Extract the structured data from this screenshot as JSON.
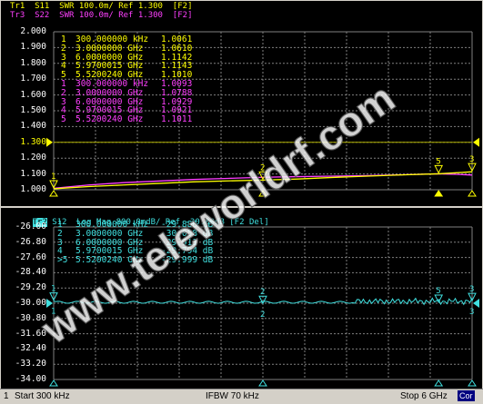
{
  "top": {
    "trace1_header": "Tr1  S11  SWR 100.0m/ Ref 1.300  [F2]",
    "trace3_header": "Tr3  S22  SWR 100.0m/ Ref 1.300  [F2]",
    "colors": {
      "tr1": "#ffff00",
      "tr3": "#ff40ff"
    },
    "y_labels": [
      "2.000",
      "1.900",
      "1.800",
      "1.700",
      "1.600",
      "1.500",
      "1.400",
      "1.300",
      "1.200",
      "1.100",
      "1.000"
    ],
    "ref_label": "1.300",
    "markers_tr1": [
      {
        "n": "1",
        "f": "300.000000 kHz",
        "v": "1.0061"
      },
      {
        "n": "2",
        "f": "3.0000000 GHz",
        "v": "1.0610"
      },
      {
        "n": "3",
        "f": "6.0000000 GHz",
        "v": "1.1142"
      },
      {
        "n": "4",
        "f": "5.9700015 GHz",
        "v": "1.1143"
      },
      {
        "n": "5",
        "f": "5.5200240 GHz",
        "v": "1.1010"
      }
    ],
    "markers_tr3": [
      {
        "n": "1",
        "f": "300.000000 kHz",
        "v": "1.0093"
      },
      {
        "n": "2",
        "f": "3.0000000 GHz",
        "v": "1.0788"
      },
      {
        "n": "3",
        "f": "6.0000000 GHz",
        "v": "1.0929"
      },
      {
        "n": "4",
        "f": "5.9700015 GHz",
        "v": "1.0921"
      },
      {
        "n": "5",
        "f": "5.5200240 GHz",
        "v": "1.1011"
      }
    ]
  },
  "bottom": {
    "trace2_tag": "Tr2",
    "trace2_header": " S12  Log Mag 800.0mdB/ Ref -30.00dB [F2 Del]",
    "color": "#40e0e0",
    "y_labels": [
      "-26.00",
      "-26.80",
      "-27.60",
      "-28.40",
      "-29.20",
      "-30.00",
      "-30.80",
      "-31.60",
      "-32.40",
      "-33.20",
      "-34.00"
    ],
    "markers": [
      {
        "n": "1",
        "f": "300.000000 kHz",
        "v": "-29.886 dB"
      },
      {
        "n": "2",
        "f": "3.0000000 GHz",
        "v": "-30.058 dB"
      },
      {
        "n": "3",
        "f": "6.0000000 GHz",
        "v": "-29.911 dB"
      },
      {
        "n": "4",
        "f": "5.9700015 GHz",
        "v": "-29.794 dB"
      },
      {
        "n": ">5",
        "f": "5.5200240 GHz",
        "v": "-29.999 dB"
      }
    ]
  },
  "status": {
    "channel": "1",
    "start": "Start 300 kHz",
    "ifbw": "IFBW 70 kHz",
    "stop": "Stop 6 GHz",
    "cor": "Cor"
  },
  "watermark": "www.teleworldrf.com"
}
